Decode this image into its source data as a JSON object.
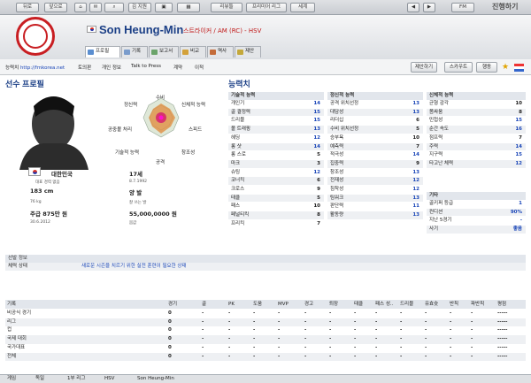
{
  "toolbar": {
    "back": "뒤로",
    "forward": "앞으로",
    "home": "",
    "inbox": "",
    "search": "",
    "squad": "김 지원",
    "club": "",
    "calendar": "",
    "reviews": "리뷰들",
    "league": "프리미어 리그",
    "world": "세계",
    "fm": "FM",
    "continue": "진행하기"
  },
  "player": {
    "name": "Son Heung-Min",
    "position": "스트라이커 / AM (RC) - HSV"
  },
  "tabs": [
    "프로필",
    "기록",
    "보고서",
    "비교",
    "역사",
    "제안"
  ],
  "subbar": {
    "nickname": "능력치",
    "url": "http://fmkorea.net",
    "links": [
      "토의판",
      "개인 정보",
      "Talk to Press",
      "계약",
      "이적"
    ],
    "right": [
      "제안하기",
      "스카우트",
      "행동"
    ]
  },
  "profile": {
    "title": "선수 프로필",
    "nationality": "대한민국",
    "nationality_sub": "대표 경력 없음",
    "age": "17세",
    "dob": "8.7.1992",
    "height": "183 cm",
    "weight": "76 kg",
    "foot": "양 발",
    "foot_sub": "잘 쓰는 발",
    "wage": "주급 875만 원",
    "contract": "30.6.2012",
    "value": "55,000,0000 원",
    "value_sub": "몸값"
  },
  "radar": {
    "labels": [
      "수비",
      "신체적 능력",
      "스피드",
      "창조성",
      "공격",
      "기술적 능력",
      "공중볼 처리",
      "정신력"
    ]
  },
  "attributes_title": "능력치",
  "technical": {
    "header": "기술적 능력",
    "rows": [
      [
        "개인기",
        "14"
      ],
      [
        "골 결정력",
        "15"
      ],
      [
        "드리블",
        "15"
      ],
      [
        "볼 트래핑",
        "13"
      ],
      [
        "헤딩",
        "12"
      ],
      [
        "롱 샷",
        "14"
      ],
      [
        "롱 스로",
        "5"
      ],
      [
        "마크",
        "3"
      ],
      [
        "슈팅",
        "12"
      ],
      [
        "코너킥",
        "6"
      ],
      [
        "크로스",
        "9"
      ],
      [
        "태클",
        "5"
      ],
      [
        "패스",
        "10"
      ],
      [
        "페널티킥",
        "8"
      ],
      [
        "프리킥",
        "7"
      ]
    ]
  },
  "mental": {
    "header": "정신적 능력",
    "rows": [
      [
        "공격 위치선정",
        "13"
      ],
      [
        "대담성",
        "13"
      ],
      [
        "리더십",
        "6"
      ],
      [
        "수비 위치선정",
        "5"
      ],
      [
        "승부욕",
        "10"
      ],
      [
        "예측력",
        "7"
      ],
      [
        "적극성",
        "14"
      ],
      [
        "집중력",
        "9"
      ],
      [
        "창조성",
        "13"
      ],
      [
        "전재성",
        "12"
      ],
      [
        "침착성",
        "12"
      ],
      [
        "팀워크",
        "13"
      ],
      [
        "판단력",
        "11"
      ],
      [
        "활동량",
        "13"
      ]
    ]
  },
  "physical": {
    "header": "신체적 능력",
    "rows": [
      [
        "균형 감각",
        "10"
      ],
      [
        "몸싸움",
        "8"
      ],
      [
        "민첩성",
        "15"
      ],
      [
        "순간 속도",
        "16"
      ],
      [
        "점프력",
        "7"
      ],
      [
        "주력",
        "14"
      ],
      [
        "지구력",
        "15"
      ],
      [
        "타고난 체력",
        "12"
      ]
    ]
  },
  "misc": {
    "header": "기타",
    "rows": [
      [
        "골키퍼 등급",
        "1"
      ],
      [
        "컨디션",
        "90%"
      ],
      [
        "지난 5경기",
        "-"
      ],
      [
        "사기",
        "좋음"
      ]
    ]
  },
  "training": {
    "header": "선발 정보",
    "label": "체력 상태",
    "text": "새로운 시즌을 치르기 위한 실전 훈련이 필요한 상태"
  },
  "stats": {
    "columns": [
      "기록",
      "경기",
      "골",
      "PK",
      "도움",
      "MVP",
      "경고",
      "퇴장",
      "태클",
      "패스 성..",
      "드리블",
      "유효슛",
      "반칙",
      "파반칙",
      "평점"
    ],
    "rows": [
      [
        "비공식 경기",
        "0",
        "-",
        "-",
        "-",
        "-",
        "-",
        "-",
        "-",
        "-",
        "-",
        "-",
        "-",
        "-",
        "-----"
      ],
      [
        "리그",
        "0",
        "-",
        "-",
        "-",
        "-",
        "-",
        "-",
        "-",
        "-",
        "-",
        "-",
        "-",
        "-",
        "-----"
      ],
      [
        "컵",
        "0",
        "-",
        "-",
        "-",
        "-",
        "-",
        "-",
        "-",
        "-",
        "-",
        "-",
        "-",
        "-",
        "-----"
      ],
      [
        "국제 대회",
        "0",
        "-",
        "-",
        "-",
        "-",
        "-",
        "-",
        "-",
        "-",
        "-",
        "-",
        "-",
        "-",
        "-----"
      ],
      [
        "국가대표",
        "0",
        "-",
        "-",
        "-",
        "-",
        "-",
        "-",
        "-",
        "-",
        "-",
        "-",
        "-",
        "-",
        "-----"
      ],
      [
        "전체",
        "0",
        "-",
        "-",
        "-",
        "-",
        "-",
        "-",
        "-",
        "-",
        "-",
        "-",
        "-",
        "-",
        "-----"
      ]
    ]
  },
  "footer": {
    "items": [
      "게임",
      "독일",
      "1부 리그",
      "HSV",
      "Son Heung-Min"
    ]
  }
}
